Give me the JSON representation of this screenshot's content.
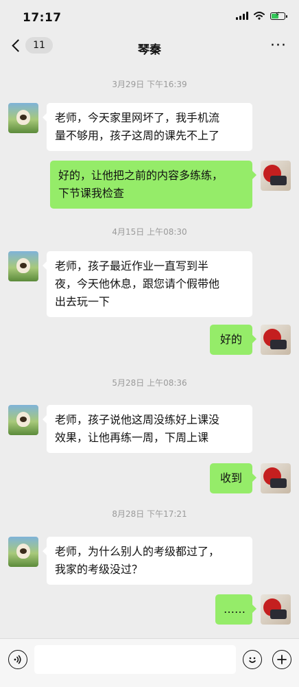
{
  "status_bar": {
    "time": "17:17",
    "battery_fill_fraction": 0.6
  },
  "nav": {
    "back_count": "11",
    "title": "琴秦",
    "more": "···"
  },
  "chat": {
    "timestamps": [
      "3月29日 下午16:39",
      "4月15日 上午08:30",
      "5月28日 上午08:36",
      "8月28日 下午17:21"
    ],
    "messages": [
      {
        "side": "left",
        "text": "老师，今天家里网坏了，我手机流\n量不够用，孩子这周的课先不上了"
      },
      {
        "side": "right",
        "text": "好的，让他把之前的内容多练练，\n下节课我检查"
      },
      {
        "side": "left",
        "text": "老师，孩子最近作业一直写到半\n夜，今天他休息，跟您请个假带他\n出去玩一下"
      },
      {
        "side": "right",
        "text": "好的"
      },
      {
        "side": "left",
        "text": "老师，孩子说他这周没练好上课没\n效果，让他再练一周，下周上课"
      },
      {
        "side": "right",
        "text": "收到"
      },
      {
        "side": "left",
        "text": "老师，为什么别人的考级都过了，\n我家的考级没过？"
      },
      {
        "side": "right",
        "text": "……"
      }
    ]
  },
  "input_bar": {
    "voice_icon": "voice-icon",
    "emoji_icon": "emoji-icon",
    "plus_icon": "plus-icon",
    "input_value": ""
  },
  "colors": {
    "background": "#ededed",
    "sent_bubble": "#95ec69",
    "received_bubble": "#ffffff",
    "timestamp_text": "#9a9a9a"
  }
}
